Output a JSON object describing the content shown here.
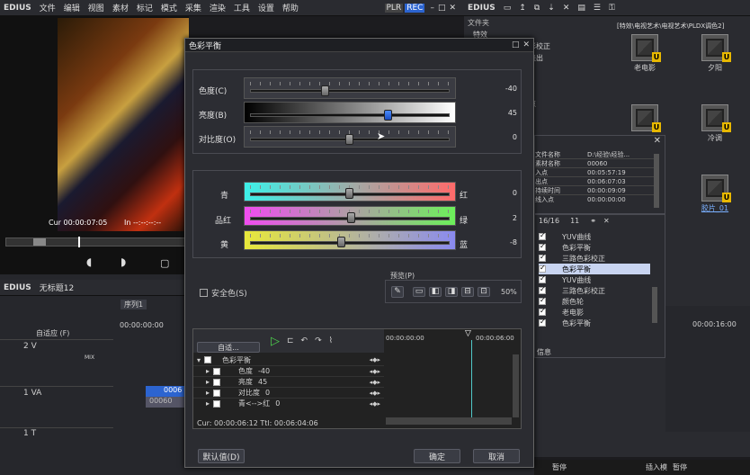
{
  "main_menu": {
    "brand": "EDIUS",
    "items": [
      "文件",
      "编辑",
      "视图",
      "素材",
      "标记",
      "模式",
      "采集",
      "渲染",
      "工具",
      "设置",
      "帮助"
    ],
    "plr": "PLR",
    "rec": "REC"
  },
  "player": {
    "cur_label": "Cur",
    "cur_time": "00:00:07:05",
    "in_label": "In",
    "in_time": "--:--:--:--"
  },
  "bin": {
    "brand": "EDIUS",
    "folder_header": "文件夹",
    "folder_tree": [
      "特效",
      "色彩校正",
      "入淡出",
      "点",
      "点",
      "出点"
    ],
    "path": "[特效\\电视艺术\\电视艺术\\PLDX调色2]",
    "clips": [
      {
        "name": "老电影"
      },
      {
        "name": "夕阳"
      },
      {
        "name": "冷调"
      },
      {
        "name": "胶片_01"
      }
    ]
  },
  "properties": {
    "rows": [
      [
        "文件名称",
        "D:\\经验\\经验..."
      ],
      [
        "素材名称",
        "00060"
      ],
      [
        "入点",
        "00:05:57:19"
      ],
      [
        "出点",
        "00:06:07:03"
      ],
      [
        "持续时间",
        "00:00:09:09"
      ],
      [
        "线入点",
        "00:00:00:00"
      ]
    ],
    "info": "信息"
  },
  "effects": {
    "count": "16/16",
    "count2": "11",
    "items": [
      {
        "label": "YUV曲线",
        "on": true
      },
      {
        "label": "色彩平衡",
        "on": true
      },
      {
        "label": "三路色彩校正",
        "on": true
      },
      {
        "label": "色彩平衡",
        "on": true,
        "selected": true
      },
      {
        "label": "YUV曲线",
        "on": true
      },
      {
        "label": "三路色彩校正",
        "on": true
      },
      {
        "label": "颜色轮",
        "on": true
      },
      {
        "label": "老电影",
        "on": true
      },
      {
        "label": "色彩平衡",
        "on": true
      }
    ]
  },
  "timeline": {
    "brand": "EDIUS",
    "title": "无标题12",
    "sequence": "序列1",
    "time_left": "00:00:00:00",
    "time_right": "00:00:16:00",
    "mode": "自适应 (F)",
    "tracks": [
      {
        "name": "2 V",
        "extra": "MIX"
      },
      {
        "name": "1 VA",
        "clip": "0006"
      },
      {
        "name": "1 T"
      }
    ],
    "clip_sub": "00060"
  },
  "dialog": {
    "title": "色彩平衡",
    "top_sliders": [
      {
        "label": "色度(C)",
        "value": "-40",
        "pos": 0.6
      },
      {
        "label": "亮度(B)",
        "value": "45",
        "pos": 0.725
      },
      {
        "label": "对比度(O)",
        "value": "0",
        "pos": 0.5
      }
    ],
    "color_sliders": [
      {
        "left": "青",
        "right": "红",
        "value": "0",
        "pos": 0.5
      },
      {
        "left": "品红",
        "right": "绿",
        "value": "2",
        "pos": 0.51
      },
      {
        "left": "黄",
        "right": "蓝",
        "value": "-8",
        "pos": 0.46
      }
    ],
    "safe_color": "安全色(S)",
    "preview_label": "预览(P)",
    "preview_pct": "50%",
    "kf_mode": "自适...",
    "kf_time_left": "00:00:00:00",
    "kf_time_right": "00:00:06:00",
    "kf_rows": [
      {
        "label": "色彩平衡"
      },
      {
        "label": "色度",
        "value": "-40"
      },
      {
        "label": "亮度",
        "value": "45"
      },
      {
        "label": "对比度",
        "value": "0"
      },
      {
        "label": "青<-->红",
        "value": "0"
      }
    ],
    "cur_line": "Cur: 00:00:06:12  Ttl: 00:06:04:06",
    "default_btn": "默认值(D)",
    "ok_btn": "确定",
    "cancel_btn": "取消"
  },
  "statusbar": {
    "pause": "暂停",
    "insert": "插入模",
    "pause2": "暂停"
  },
  "colors": {
    "accent": "#2c64d0",
    "track": "#1e2a4a"
  }
}
